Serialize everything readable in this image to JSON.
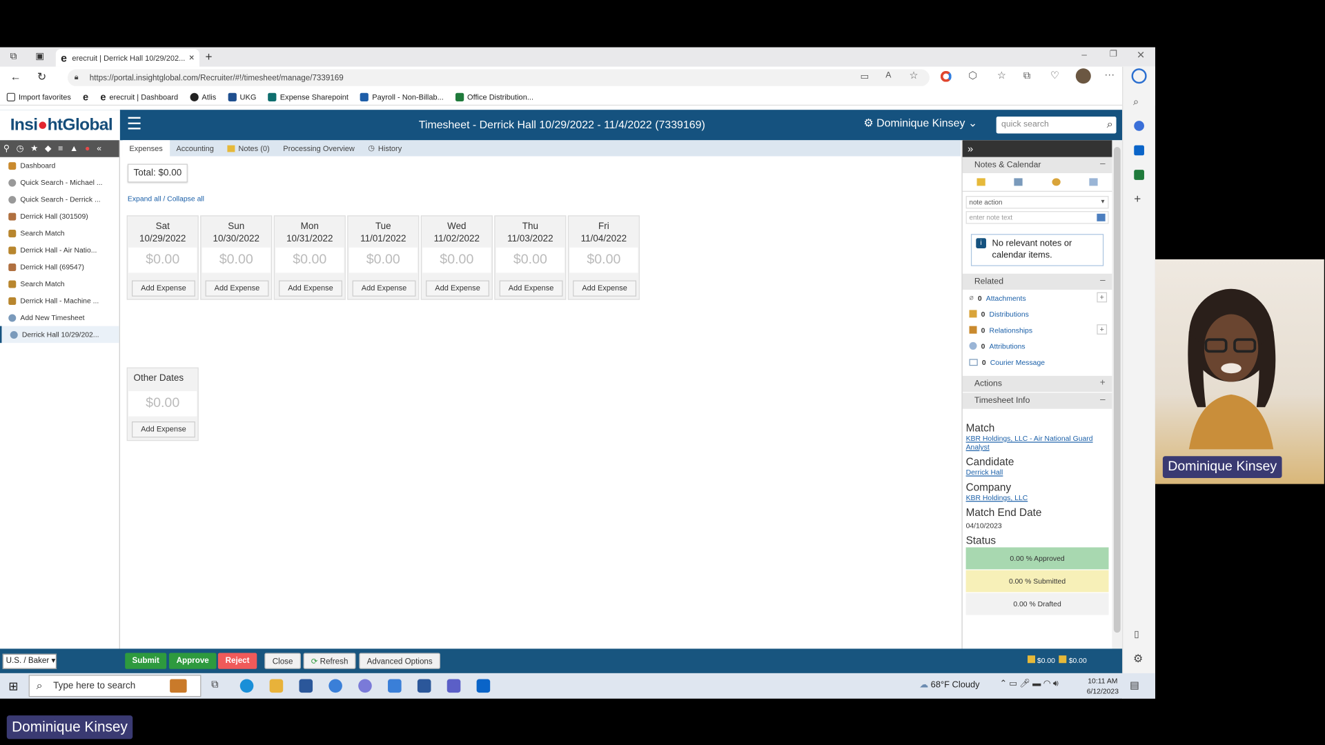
{
  "browser": {
    "tab_title": "erecruit | Derrick Hall 10/29/202...",
    "url": "https://portal.insightglobal.com/Recruiter/#!/timesheet/manage/7339169",
    "favorites": [
      "Import favorites",
      "erecruit | Dashboard",
      "Atlis",
      "UKG",
      "Expense Sharepoint",
      "Payroll - Non-Billab...",
      "Office Distribution..."
    ]
  },
  "header": {
    "logo": "InsightGlobal",
    "title": "Timesheet - Derrick Hall 10/29/2022 - 11/4/2022 (7339169)",
    "user": "Dominique Kinsey",
    "search_placeholder": "quick search"
  },
  "sidebar": {
    "items": [
      {
        "label": "Dashboard"
      },
      {
        "label": "Quick Search - Michael ..."
      },
      {
        "label": "Quick Search - Derrick ..."
      },
      {
        "label": "Derrick Hall (301509)"
      },
      {
        "label": "Search Match"
      },
      {
        "label": "Derrick Hall - Air Natio..."
      },
      {
        "label": "Derrick Hall (69547)"
      },
      {
        "label": "Search Match"
      },
      {
        "label": "Derrick Hall - Machine ..."
      },
      {
        "label": "Add New Timesheet"
      },
      {
        "label": "Derrick Hall 10/29/202..."
      }
    ]
  },
  "tabs": [
    "Expenses",
    "Accounting",
    "Notes (0)",
    "Processing Overview",
    "History"
  ],
  "main": {
    "total": "Total: $0.00",
    "expand_collapse": "Expand all / Collapse all",
    "days": [
      {
        "day": "Sat",
        "date": "10/29/2022",
        "amount": "$0.00",
        "button": "Add Expense"
      },
      {
        "day": "Sun",
        "date": "10/30/2022",
        "amount": "$0.00",
        "button": "Add Expense"
      },
      {
        "day": "Mon",
        "date": "10/31/2022",
        "amount": "$0.00",
        "button": "Add Expense"
      },
      {
        "day": "Tue",
        "date": "11/01/2022",
        "amount": "$0.00",
        "button": "Add Expense"
      },
      {
        "day": "Wed",
        "date": "11/02/2022",
        "amount": "$0.00",
        "button": "Add Expense"
      },
      {
        "day": "Thu",
        "date": "11/03/2022",
        "amount": "$0.00",
        "button": "Add Expense"
      },
      {
        "day": "Fri",
        "date": "11/04/2022",
        "amount": "$0.00",
        "button": "Add Expense"
      }
    ],
    "other_dates": {
      "label": "Other Dates",
      "amount": "$0.00",
      "button": "Add Expense"
    }
  },
  "right_panel": {
    "notes_title": "Notes & Calendar",
    "note_action": "note action",
    "note_placeholder": "enter note text",
    "no_notes": "No relevant notes or calendar items.",
    "related_title": "Related",
    "related": [
      {
        "count": "0",
        "label": "Attachments"
      },
      {
        "count": "0",
        "label": "Distributions"
      },
      {
        "count": "0",
        "label": "Relationships"
      },
      {
        "count": "0",
        "label": "Attributions"
      },
      {
        "count": "0",
        "label": "Courier Message"
      }
    ],
    "actions_title": "Actions",
    "info_title": "Timesheet Info",
    "match_label": "Match",
    "match_value": "KBR Holdings, LLC - Air National Guard Analyst",
    "candidate_label": "Candidate",
    "candidate_value": "Derrick Hall",
    "company_label": "Company",
    "company_value": "KBR Holdings, LLC",
    "end_label": "Match End Date",
    "end_value": "04/10/2023",
    "status_label": "Status",
    "statuses": [
      "0.00 % Approved",
      "0.00 % Submitted",
      "0.00 % Drafted"
    ],
    "colors": {
      "approved": "#a8d8b0",
      "submitted": "#f7f0b8",
      "drafted": "#f2f2f2"
    }
  },
  "bottom": {
    "region": "U.S. / Baker",
    "submit": "Submit",
    "approve": "Approve",
    "reject": "Reject",
    "close": "Close",
    "refresh": "Refresh",
    "advanced": "Advanced Options",
    "amt1": "$0.00",
    "amt2": "$0.00"
  },
  "taskbar": {
    "search": "Type here to search",
    "weather": "68°F  Cloudy",
    "time": "10:11 AM",
    "date": "6/12/2023"
  },
  "video": {
    "name": "Dominique Kinsey"
  },
  "caption": {
    "name": "Dominique Kinsey"
  }
}
